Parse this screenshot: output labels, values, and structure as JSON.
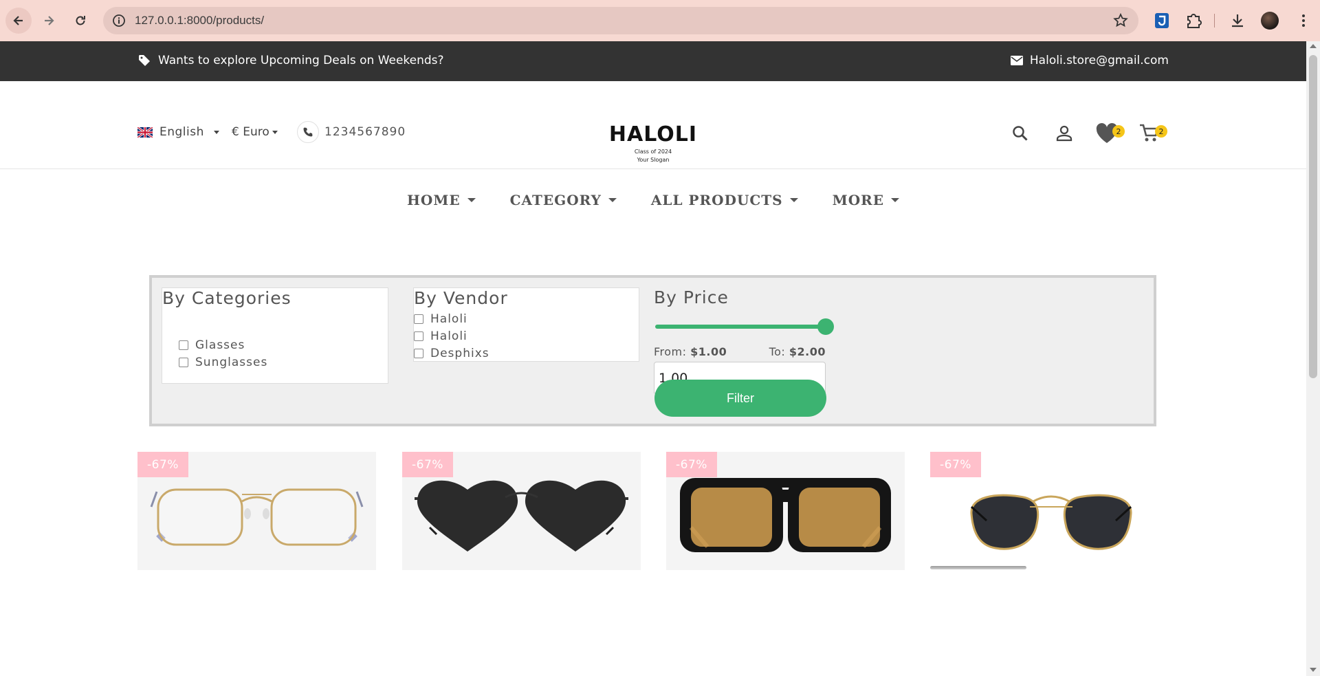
{
  "browser": {
    "url": "127.0.0.1:8000/products/",
    "icons": [
      "back-icon",
      "forward-icon",
      "reload-icon",
      "info-icon",
      "star-icon",
      "extension-icon",
      "puzzle-icon",
      "download-icon",
      "profile-avatar",
      "more-icon"
    ]
  },
  "topbar": {
    "promo": "Wants to explore Upcoming Deals on Weekends?",
    "email": "Haloli.store@gmail.com"
  },
  "header": {
    "language": "English",
    "currency": "€ Euro",
    "phone": "1234567890",
    "logo": {
      "name": "HALOLI",
      "line1": "Class of 2024",
      "line2": "Your Slogan"
    },
    "wishlist_count": "2",
    "cart_count": "2"
  },
  "nav": {
    "items": [
      {
        "label": "HOME"
      },
      {
        "label": "CATEGORY"
      },
      {
        "label": "ALL PRODUCTS"
      },
      {
        "label": "MORE"
      }
    ]
  },
  "filters": {
    "categories": {
      "title": "By Categories",
      "options": [
        "Glasses",
        "Sunglasses"
      ]
    },
    "vendor": {
      "title": "By Vendor",
      "options": [
        "Haloli",
        "Haloli",
        "Desphixs"
      ]
    },
    "price": {
      "title": "By Price",
      "from_label": "From:",
      "from_value": "$1.00",
      "to_label": "To:",
      "to_value": "$2.00",
      "input_value": "1,00",
      "slider_level": 1.0,
      "button": "Filter"
    }
  },
  "products": [
    {
      "discount": "-67%",
      "image": "gold-frame-glasses"
    },
    {
      "discount": "-67%",
      "image": "heart-sunglasses"
    },
    {
      "discount": "-67%",
      "image": "amber-aviator-sunglasses"
    },
    {
      "discount": "-67%",
      "image": "gold-aviator-sunglasses"
    }
  ],
  "colors": {
    "accent_green": "#3cb371",
    "badge_yellow": "#f5c518",
    "discount_pink": "#ffc0cb",
    "topbar_bg": "#333333",
    "chrome_bg": "#f7d9d2"
  }
}
